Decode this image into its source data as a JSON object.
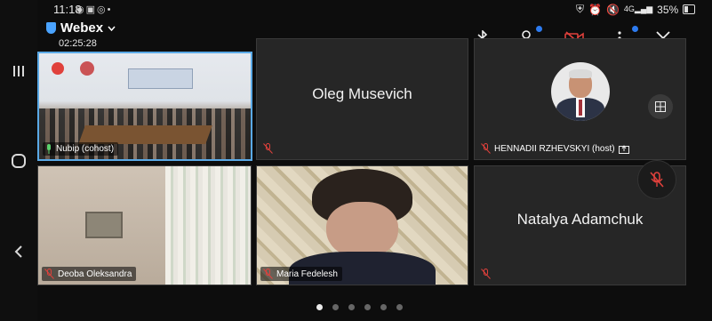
{
  "status": {
    "time": "11:18",
    "battery": "35%"
  },
  "app": {
    "title": "Webex",
    "duration": "02:25:28"
  },
  "tiles": [
    {
      "name": "Nubip (cohost)"
    },
    {
      "name": "Oleg Musevich"
    },
    {
      "name": "HENNADII RZHEVSKYI (host)"
    },
    {
      "name": "Deoba Oleksandra"
    },
    {
      "name": "Maria Fedelesh"
    },
    {
      "name": "Natalya Adamchuk"
    }
  ],
  "pager": {
    "total": 6,
    "current": 1
  },
  "colors": {
    "accent": "#5aa9e6",
    "mute_red": "#e0413c",
    "badge_blue": "#2d7bf0"
  }
}
